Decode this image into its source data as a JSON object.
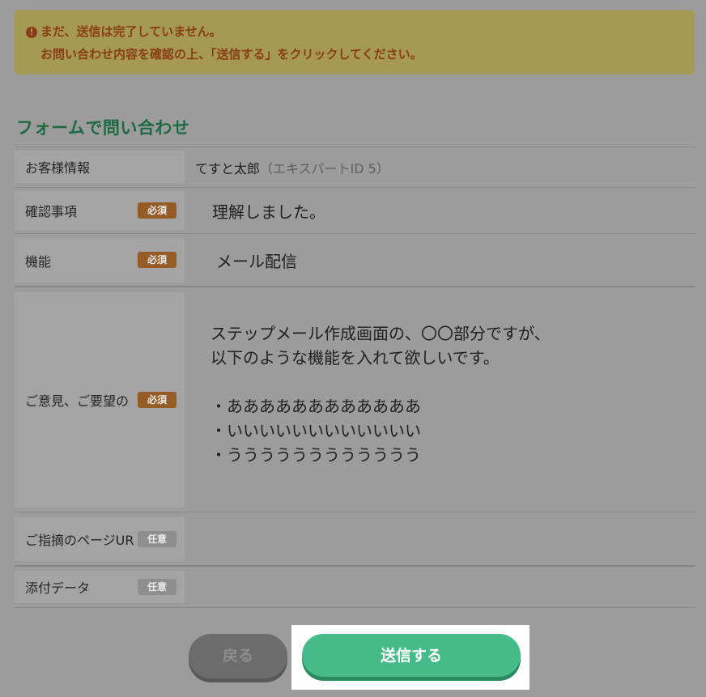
{
  "alert": {
    "icon": "exclamation-circle-icon",
    "line1": "まだ、送信は完了していません。",
    "line2": "お問い合わせ内容を確認の上、「送信する」をクリックしてください。"
  },
  "form": {
    "title": "フォームで問い合わせ",
    "rows": [
      {
        "label": "お客様情報",
        "badge": "",
        "value": "てすと太郎",
        "value_extra": "（エキスパートID 5）"
      },
      {
        "label": "確認事項",
        "badge": "必須",
        "value": "理解しました。"
      },
      {
        "label": "機能",
        "badge": "必須",
        "value": "メール配信"
      },
      {
        "label": "ご意見、ご要望の",
        "badge": "必須",
        "value_lines": [
          "ステップメール作成画面の、〇〇部分ですが、",
          "以下のような機能を入れて欲しいです。",
          "",
          "・ああああああああああああ",
          "・いいいいいいいいいいいい",
          "・うううううううううううう"
        ]
      },
      {
        "label": "ご指摘のページUR",
        "badge": "任意",
        "value": ""
      },
      {
        "label": "添付データ",
        "badge": "任意",
        "value": ""
      }
    ]
  },
  "buttons": {
    "back": "戻る",
    "submit": "送信する"
  },
  "colors": {
    "overlay_bg": "#9c9c9c",
    "required_badge": "#955c26",
    "optional_badge": "#8e8e8e",
    "submit": "#44bb88",
    "title": "#1d6a45"
  }
}
